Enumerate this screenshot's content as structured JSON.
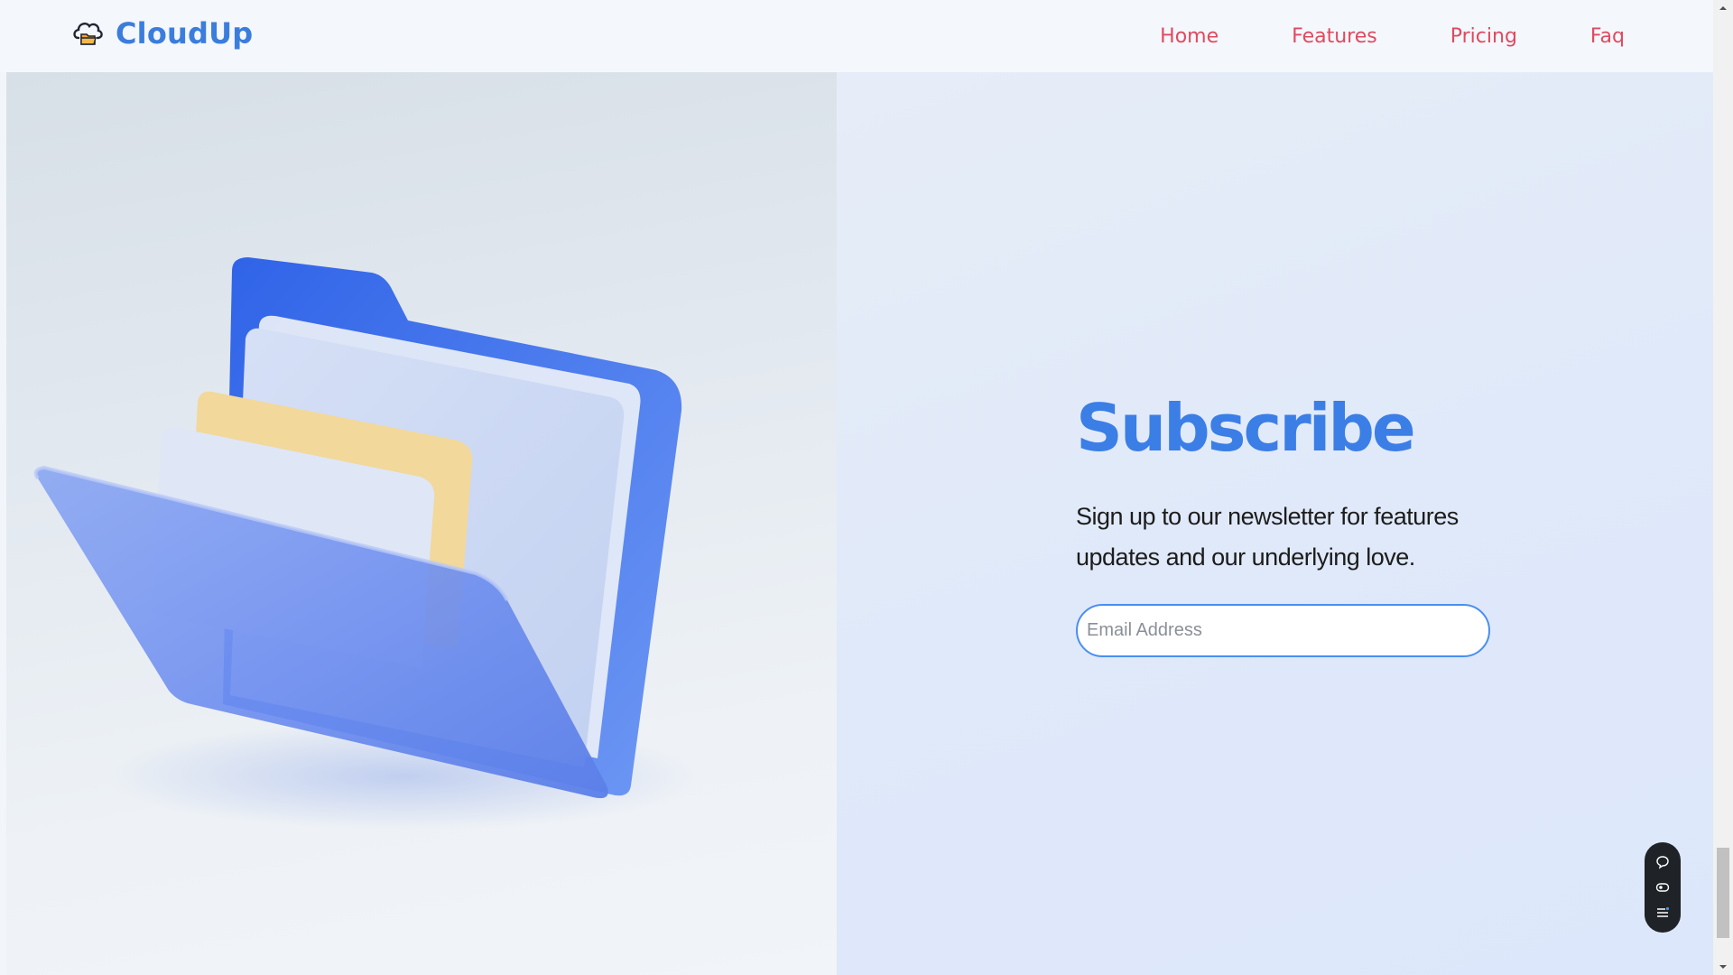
{
  "brand": {
    "name": "CloudUp",
    "logo_icon": "cloud-folder-icon",
    "color": "#3b7ddd"
  },
  "nav": {
    "items": [
      {
        "label": "Home"
      },
      {
        "label": "Features"
      },
      {
        "label": "Pricing"
      },
      {
        "label": "Faq"
      }
    ],
    "color": "#e04a5f"
  },
  "hero": {
    "image": "blue-folder-illustration"
  },
  "subscribe": {
    "title": "Subscribe",
    "description": "Sign up to our newsletter for features updates and our underlying love.",
    "email_placeholder": "Email Address",
    "accent": "#3b7ee6"
  },
  "floating_toolbar": {
    "buttons": [
      "chat-bubble-icon",
      "eye-icon",
      "list-icon"
    ]
  },
  "scrollbar": {
    "position_fraction": 1.0
  }
}
